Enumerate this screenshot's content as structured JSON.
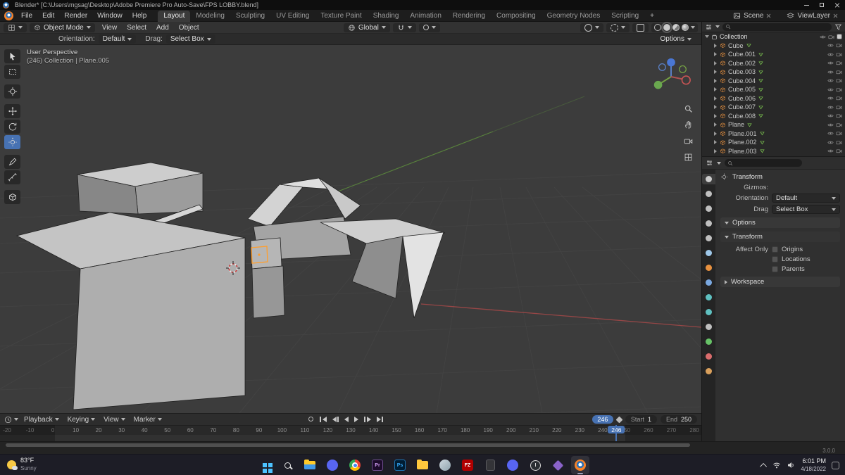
{
  "colors": {
    "accent": "#4772b3",
    "selection": "#ff9e2c",
    "axis_x": "#a04848",
    "axis_y": "#5e8f3c",
    "blender_orange": "#ea7600"
  },
  "titlebar": {
    "title": "Blender* [C:\\Users\\mgsag\\Desktop\\Adobe Premiere Pro Auto-Save\\FPS LOBBY.blend]"
  },
  "menubar": {
    "menus": [
      "File",
      "Edit",
      "Render",
      "Window",
      "Help"
    ],
    "workspaces": [
      "Layout",
      "Modeling",
      "Sculpting",
      "UV Editing",
      "Texture Paint",
      "Shading",
      "Animation",
      "Rendering",
      "Compositing",
      "Geometry Nodes",
      "Scripting"
    ],
    "active_workspace": "Layout",
    "add_tab": "+",
    "scene_label": "Scene",
    "viewlayer_label": "ViewLayer"
  },
  "viewport": {
    "mode": "Object Mode",
    "menus": [
      "View",
      "Select",
      "Add",
      "Object"
    ],
    "orientation_global": "Global",
    "tool_settings": {
      "orientation_label": "Orientation:",
      "orientation_value": "Default",
      "drag_label": "Drag:",
      "drag_value": "Select Box",
      "options_label": "Options"
    },
    "overlay_line1": "User Perspective",
    "overlay_line2": "(246) Collection | Plane.005",
    "tools": [
      "tweak",
      "select-box",
      "cursor",
      "move",
      "rotate",
      "transform",
      "annotate",
      "measure",
      "add-cube"
    ],
    "active_tool": "transform",
    "side_tools": [
      "zoom",
      "pan",
      "camera-view",
      "toggle-orthographic"
    ]
  },
  "outliner": {
    "root": "Collection",
    "items": [
      "Cube",
      "Cube.001",
      "Cube.002",
      "Cube.003",
      "Cube.004",
      "Cube.005",
      "Cube.006",
      "Cube.007",
      "Cube.008",
      "Plane",
      "Plane.001",
      "Plane.002",
      "Plane.003"
    ]
  },
  "properties": {
    "tabs": [
      "tool",
      "render",
      "output",
      "view-layer",
      "scene",
      "world",
      "object",
      "modifiers",
      "particles",
      "physics",
      "constraints",
      "object-data",
      "material",
      "texture"
    ],
    "active_tab": "tool",
    "tool_name": "Transform",
    "gizmos_label": "Gizmos:",
    "orientation_label": "Orientation",
    "orientation_value": "Default",
    "drag_label": "Drag",
    "drag_value": "Select Box",
    "panels": {
      "options": "Options",
      "transform": "Transform",
      "affect_only": "Affect Only",
      "checkboxes": [
        "Origins",
        "Locations",
        "Parents"
      ],
      "workspace": "Workspace"
    }
  },
  "timeline": {
    "menus": [
      "Playback",
      "Keying",
      "View",
      "Marker"
    ],
    "controls": [
      "jump-to-start",
      "previous-keyframe",
      "play-reverse",
      "play",
      "next-keyframe",
      "jump-to-end"
    ],
    "current_frame": "246",
    "start_label": "Start",
    "start_value": "1",
    "end_label": "End",
    "end_value": "250",
    "ticks": [
      -20,
      -10,
      0,
      10,
      20,
      30,
      40,
      50,
      60,
      70,
      80,
      90,
      100,
      110,
      120,
      130,
      140,
      150,
      160,
      170,
      180,
      190,
      200,
      210,
      220,
      230,
      240,
      250,
      260,
      270,
      280
    ],
    "playhead_frame": 246,
    "range_start": 1,
    "range_end": 250
  },
  "statusbar": {
    "version": "3.0.0"
  },
  "taskbar": {
    "weather_temp": "83°F",
    "weather_desc": "Sunny",
    "icons": [
      {
        "name": "start"
      },
      {
        "name": "search"
      },
      {
        "name": "file-explorer"
      },
      {
        "name": "discord"
      },
      {
        "name": "chrome"
      },
      {
        "name": "premiere-pro",
        "text": "Pr"
      },
      {
        "name": "photoshop",
        "text": "Ps"
      },
      {
        "name": "folder"
      },
      {
        "name": "steam"
      },
      {
        "name": "filezilla",
        "text": "FZ"
      },
      {
        "name": "epic-games"
      },
      {
        "name": "discord-alt"
      },
      {
        "name": "clock-app"
      },
      {
        "name": "visual-studio"
      },
      {
        "name": "blender",
        "active": true
      }
    ],
    "tray_time": "6:01 PM",
    "tray_date": "4/18/2022"
  }
}
